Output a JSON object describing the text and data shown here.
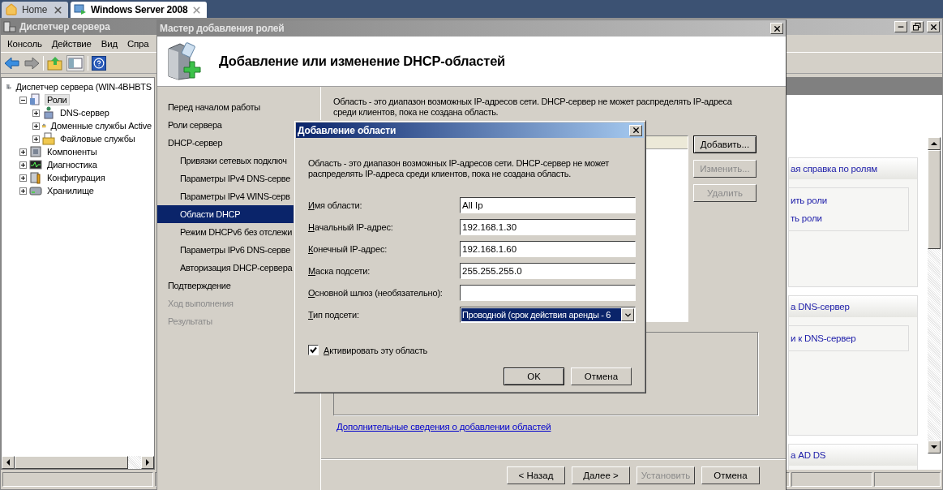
{
  "browser_tabs": [
    {
      "label": "Home",
      "selected": false
    },
    {
      "label": "Windows Server 2008",
      "selected": true
    }
  ],
  "server_manager": {
    "title": "Диспетчер сервера",
    "menu": [
      "Консоль",
      "Действие",
      "Вид",
      "Спра"
    ],
    "tree": [
      {
        "label": "Диспетчер сервера (WIN-4BHBTS",
        "kind": "server",
        "selected": false,
        "children": [
          {
            "label": "Роли",
            "kind": "roles",
            "selected": true,
            "expanded": true,
            "children": [
              {
                "label": "DNS-сервер",
                "kind": "dns",
                "selected": false,
                "expanded": false
              },
              {
                "label": "Доменные службы Active",
                "kind": "ad",
                "selected": false,
                "expanded": false
              },
              {
                "label": "Файловые службы",
                "kind": "files",
                "selected": false,
                "expanded": false
              }
            ]
          },
          {
            "label": "Компоненты",
            "kind": "features",
            "selected": false,
            "expanded": false
          },
          {
            "label": "Диагностика",
            "kind": "diagnostics",
            "selected": false,
            "expanded": false
          },
          {
            "label": "Конфигурация",
            "kind": "config",
            "selected": false,
            "expanded": false
          },
          {
            "label": "Хранилище",
            "kind": "storage",
            "selected": false,
            "expanded": false
          }
        ]
      }
    ],
    "cards": [
      {
        "header": "ая справка по ролям",
        "links": [
          "ить роли",
          "ть роли"
        ]
      },
      {
        "header": "а DNS-сервер",
        "links": [
          "и к DNS-сервер"
        ]
      },
      {
        "header": "а AD DS"
      }
    ]
  },
  "wizard": {
    "title": "Мастер добавления ролей",
    "heading": "Добавление или изменение DHCP-областей",
    "steps": [
      {
        "label": "Перед началом работы",
        "selected": false,
        "disabled": false
      },
      {
        "label": "Роли сервера",
        "selected": false,
        "disabled": false
      },
      {
        "label": "DHCP-сервер",
        "selected": false,
        "disabled": false,
        "children": [
          {
            "label": "Привязки сетевых подключ",
            "selected": false,
            "disabled": false
          },
          {
            "label": "Параметры IPv4 DNS-серве",
            "selected": false,
            "disabled": false
          },
          {
            "label": "Параметры IPv4 WINS-серв",
            "selected": false,
            "disabled": false
          },
          {
            "label": "Области DHCP",
            "selected": true,
            "disabled": false
          },
          {
            "label": "Режим DHCPv6 без отслежи",
            "selected": false,
            "disabled": false
          },
          {
            "label": "Параметры IPv6 DNS-серве",
            "selected": false,
            "disabled": false
          },
          {
            "label": "Авторизация DHCP-сервера",
            "selected": false,
            "disabled": false
          }
        ]
      },
      {
        "label": "Подтверждение",
        "selected": false,
        "disabled": false
      },
      {
        "label": "Ход выполнения",
        "selected": false,
        "disabled": true
      },
      {
        "label": "Результаты",
        "selected": false,
        "disabled": true
      }
    ],
    "description": "Область - это диапазон возможных IP-адресов сети. DHCP-сервер не может распределять IP-адреса\nсреди клиентов, пока не создана область.",
    "list_buttons": [
      {
        "label": "Добавить...",
        "disabled": false,
        "default": true
      },
      {
        "label": "Изменить...",
        "disabled": true,
        "default": false
      },
      {
        "label": "Удалить",
        "disabled": true,
        "default": false
      }
    ],
    "link": "Дополнительные сведения о добавлении областей",
    "nav_buttons": [
      {
        "label": "< Назад",
        "disabled": false
      },
      {
        "label": "Далее >",
        "disabled": false
      },
      {
        "label": "Установить",
        "disabled": true
      },
      {
        "label": "Отмена",
        "disabled": false
      }
    ]
  },
  "dialog": {
    "title": "Добавление области",
    "description": "Область - это диапазон возможных IP-адресов сети. DHCP-сервер не может\nраспределять IP-адреса среди клиентов, пока не создана область.",
    "fields": [
      {
        "label": "Имя области:",
        "kind": "text",
        "value": "All Ip"
      },
      {
        "label": "Начальный IP-адрес:",
        "kind": "text",
        "value": "192.168.1.30"
      },
      {
        "label": "Конечный IP-адрес:",
        "kind": "text",
        "value": "192.168.1.60"
      },
      {
        "label": "Маска подсети:",
        "kind": "text",
        "value": "255.255.255.0"
      },
      {
        "label": "Основной шлюз (необязательно):",
        "kind": "text"
      },
      {
        "label": "Тип подсети:",
        "kind": "select",
        "value": "Проводной (срок действия аренды - 6"
      }
    ],
    "checkbox": {
      "label": "Активировать эту область",
      "checked": true
    },
    "buttons": [
      {
        "label": "OK",
        "default": true
      },
      {
        "label": "Отмена",
        "default": false
      }
    ]
  }
}
